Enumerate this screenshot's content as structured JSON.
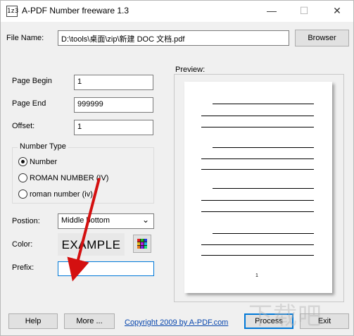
{
  "window": {
    "title": "A-PDF Number freeware 1.3",
    "icon_text": "1z3",
    "min_glyph": "—",
    "max_glyph": "☐",
    "close_glyph": "✕"
  },
  "file": {
    "label": "File Name:",
    "value": "D:\\tools\\桌面\\zip\\新建 DOC 文档.pdf",
    "browse_label": "Browser"
  },
  "fields": {
    "page_begin_label": "Page Begin",
    "page_begin_value": "1",
    "page_end_label": "Page End",
    "page_end_value": "999999",
    "offset_label": "Offset:",
    "offset_value": "1"
  },
  "number_type": {
    "title": "Number Type",
    "options": [
      {
        "label": "Number",
        "selected": true
      },
      {
        "label": "ROMAN NUMBER (IV)",
        "selected": false
      },
      {
        "label": "roman number (iv)",
        "selected": false
      }
    ]
  },
  "position": {
    "label": "Postion:",
    "value": "Middle bottom"
  },
  "color": {
    "label": "Color:",
    "example_text": "EXAMPLE",
    "palette": [
      "#e21b1b",
      "#1bb51b",
      "#1b3ce2",
      "#e2b51b",
      "#b51be2",
      "#1bb5e2",
      "#e27a1b",
      "#7a1be2",
      "#1be27a"
    ]
  },
  "prefix": {
    "label": "Prefix:",
    "value": ""
  },
  "preview": {
    "label": "Preview:",
    "page_number": "1"
  },
  "buttons": {
    "help": "Help",
    "more": "More ...",
    "process": "Process",
    "exit": "Exit"
  },
  "footer": {
    "copyright": "Copyright 2009 by A-PDF.com"
  },
  "watermark": "下载吧"
}
